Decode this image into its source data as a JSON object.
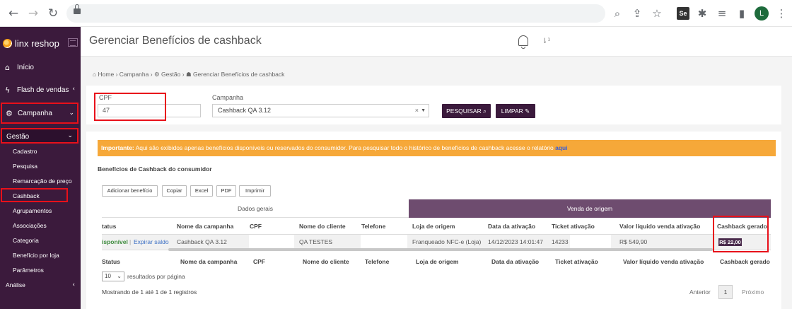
{
  "browser": {
    "profile_initial": "L",
    "extension_label": "Se"
  },
  "sidebar": {
    "brand": "linx reshop",
    "items": [
      {
        "icon": "home-icon",
        "label": "Início"
      },
      {
        "icon": "bolt-icon",
        "label": "Flash de vendas"
      },
      {
        "icon": "gear-icon",
        "label": "Campanha"
      },
      {
        "label": "Gestão"
      }
    ],
    "sub_items": [
      "Cadastro",
      "Pesquisa",
      "Remarcação de preço",
      "Cashback",
      "Agrupamentos",
      "Associações",
      "Categoria",
      "Benefício por loja",
      "Parâmetros"
    ],
    "analysis": "Análise"
  },
  "header": {
    "title": "Gerenciar Benefícios de cashback"
  },
  "breadcrumb": {
    "home": "Home",
    "campanha": "Campanha",
    "gestao": "Gestão",
    "current": "Gerenciar Benefícios de cashback"
  },
  "search": {
    "cpf_label": "CPF",
    "cpf_value": "47",
    "campaign_label": "Campanha",
    "campaign_value": "Cashback QA 3.12",
    "search_button": "PESQUISAR",
    "clear_button": "LIMPAR"
  },
  "notice": {
    "strong": "Importante:",
    "text": " Aqui são exibidos apenas benefícios disponíveis ou reservados do consumidor. Para pesquisar todo o histórico de benefícios de cashback acesse o relatório ",
    "link": "aqui"
  },
  "section_title": "Benefícios de Cashback do consumidor",
  "toolbar": [
    "Adicionar benefício",
    "Copiar",
    "Excel",
    "PDF",
    "Imprimir"
  ],
  "table": {
    "group_left": "Dados gerais",
    "group_right": "Venda de origem",
    "headers": [
      "Status",
      "Nome da campanha",
      "CPF",
      "Nome do cliente",
      "Telefone",
      "Loja de origem",
      "Data da ativação",
      "Ticket ativação",
      "Valor líquido venda ativação",
      "Cashback gerado"
    ],
    "header_status_clipped": "tatus",
    "row": {
      "status": "isponível",
      "separator": "|",
      "action": "Expirar saldo",
      "campaign": "Cashback QA 3.12",
      "client": "QA TESTES",
      "store": "Franqueado NFC-e (Loja)",
      "date": "14/12/2023 14:01:47",
      "ticket": "14233",
      "net_value": "R$ 549,90",
      "cashback": "R$ 22,00"
    }
  },
  "footer": {
    "page_length": "10",
    "page_length_label": "resultados por página",
    "info": "Mostrando de 1 até 1 de 1 registros",
    "prev": "Anterior",
    "current_page": "1",
    "next": "Próximo"
  },
  "colors": {
    "sidebar": "#3b1a3c",
    "accent": "#6e4c6f",
    "notice": "#f6a839",
    "highlight": "#e8101a"
  }
}
